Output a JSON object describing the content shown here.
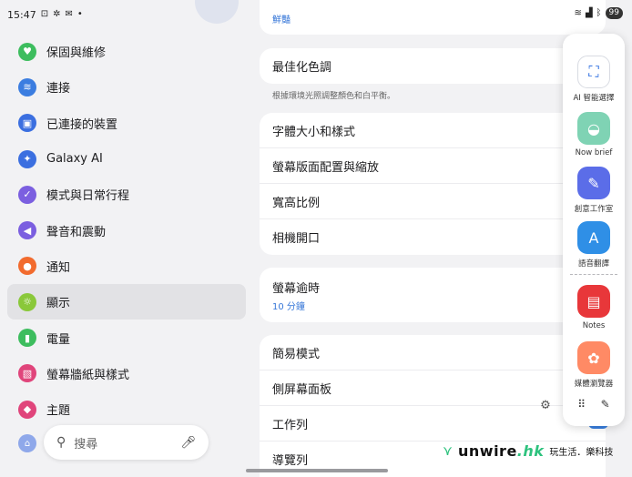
{
  "status_bar": {
    "time": "15:47",
    "icons": [
      "screenshot-icon",
      "gear-icon",
      "message-icon",
      "dot-icon"
    ],
    "battery": "99"
  },
  "sidebar": {
    "items": [
      {
        "label": "保固與維修",
        "icon": "heart-icon",
        "color": "#3dbd5e",
        "glyph": "♥"
      },
      {
        "label": "連接",
        "icon": "wifi-icon",
        "color": "#3b7de0",
        "glyph": "≋"
      },
      {
        "label": "已連接的裝置",
        "icon": "devices-icon",
        "color": "#3b6fe0",
        "glyph": "▣"
      },
      {
        "label": "Galaxy AI",
        "icon": "sparkle-icon",
        "color": "#3b6fe0",
        "glyph": "✦"
      },
      {
        "label": "模式與日常行程",
        "icon": "check-circle-icon",
        "color": "#7b5fe0",
        "glyph": "✓"
      },
      {
        "label": "聲音和震動",
        "icon": "speaker-icon",
        "color": "#7b5fe0",
        "glyph": "◀"
      },
      {
        "label": "通知",
        "icon": "bell-icon",
        "color": "#f26b2e",
        "glyph": "●"
      },
      {
        "label": "顯示",
        "icon": "sun-icon",
        "color": "#8ac83a",
        "glyph": "☼"
      },
      {
        "label": "電量",
        "icon": "battery-icon",
        "color": "#3dbd5e",
        "glyph": "▮"
      },
      {
        "label": "螢幕牆紙與樣式",
        "icon": "wallpaper-icon",
        "color": "#e0457b",
        "glyph": "▧"
      },
      {
        "label": "主題",
        "icon": "theme-icon",
        "color": "#e0457b",
        "glyph": "◆"
      }
    ],
    "active_index": 7
  },
  "search": {
    "placeholder": "搜尋"
  },
  "content": {
    "top_partial": {
      "sub": "鮮豔"
    },
    "card1": {
      "label": "最佳化色調"
    },
    "card1_hint": "根據環境光照調整顏色和白平衡。",
    "card2": [
      "字體大小和樣式",
      "螢幕版面配置與縮放",
      "寬高比例",
      "相機開口"
    ],
    "card3": {
      "label": "螢幕逾時",
      "sub": "10 分鐘"
    },
    "card4": [
      "簡易模式",
      "側屏幕面板",
      "工作列",
      "導覽列"
    ]
  },
  "edge_panel": {
    "apps": [
      {
        "label": "AI 智能選擇",
        "icon": "ai-select-icon",
        "color": "#ffffff"
      },
      {
        "label": "Now brief",
        "icon": "now-brief-icon",
        "color": "#7fd3b4"
      },
      {
        "label": "創意工作室",
        "icon": "studio-icon",
        "color": "#5b6de8"
      },
      {
        "label": "語音翻譯",
        "icon": "translate-icon",
        "color": "#2f8fe6"
      },
      {
        "label": "Notes",
        "icon": "notes-icon",
        "color": "#e8373a"
      },
      {
        "label": "媒體瀏覽器",
        "icon": "gallery-icon",
        "color": "#ff8a65"
      }
    ]
  },
  "watermark": {
    "brand": "unwire",
    "suffix": ".hk",
    "tagline": "玩生活．樂科技"
  }
}
